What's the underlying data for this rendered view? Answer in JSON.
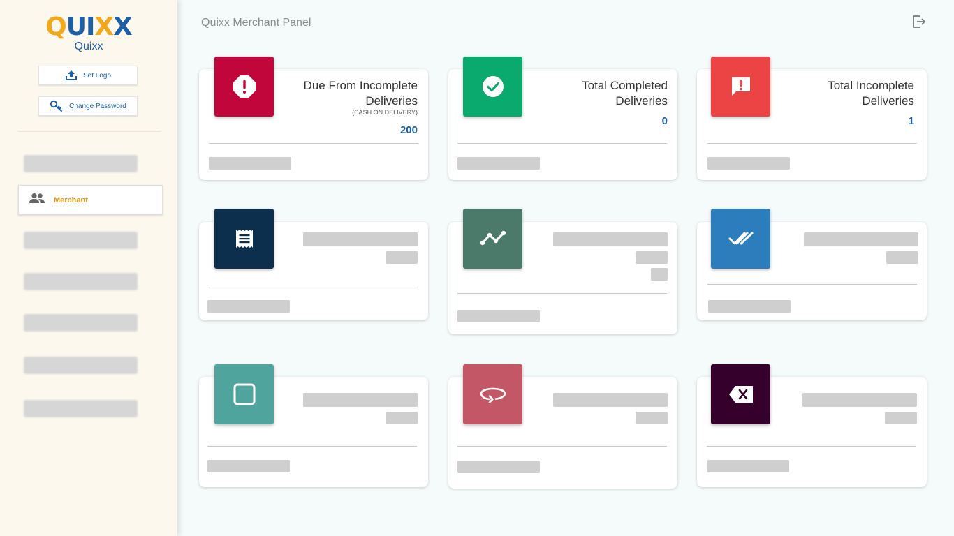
{
  "logo": {
    "q": "Q",
    "u": "U",
    "i": "I",
    "x1": "X",
    "x2": "X",
    "name": "Quixx"
  },
  "sidebar": {
    "set_logo": "Set Logo",
    "change_password": "Change Password",
    "active_item": "Merchant"
  },
  "header": {
    "title": "Quixx Merchant Panel"
  },
  "cards": {
    "due": {
      "title_line1": "Due From Incomplete",
      "title_line2": "Deliveries",
      "note": "(CASH ON DELIVERY)",
      "value": "200",
      "color": "#c0063a"
    },
    "completed": {
      "title_line1": "Total Completed",
      "title_line2": "Deliveries",
      "value": "0",
      "color": "#0aa96d"
    },
    "incomplete": {
      "title_line1": "Total Incomplete",
      "title_line2": "Deliveries",
      "value": "1",
      "color": "#ec4445"
    },
    "r2c1_color": "#0c2f4e",
    "r2c2_color": "#4b7a6a",
    "r2c3_color": "#2b7dbb",
    "r3c1_color": "#4fa49e",
    "r3c2_color": "#c45766",
    "r3c3_color": "#35012c"
  },
  "icons": {
    "set_logo": "upload-icon",
    "change_password": "key-icon",
    "merchant": "people-icon",
    "logout": "logout-icon"
  }
}
